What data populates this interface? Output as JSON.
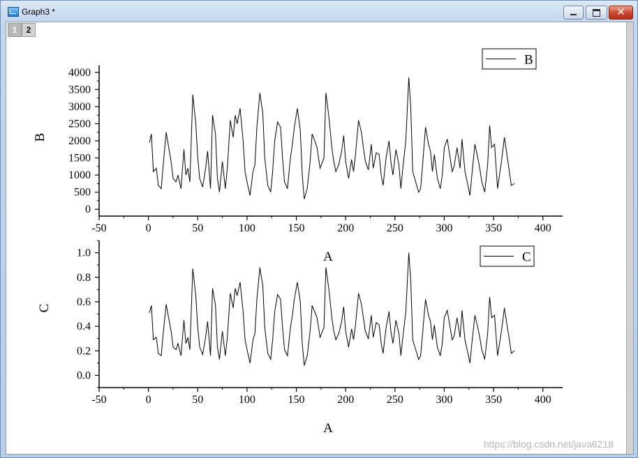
{
  "window": {
    "title": "Graph3 *"
  },
  "pages": [
    "1",
    "2"
  ],
  "watermark": "https://blog.csdn.net/java6218",
  "chart_data": [
    {
      "type": "line",
      "xlabel": "A",
      "ylabel": "B",
      "xlim": [
        -50,
        420
      ],
      "ylim": [
        -200,
        4200
      ],
      "xticks": [
        -50,
        0,
        50,
        100,
        150,
        200,
        250,
        300,
        350,
        400
      ],
      "yticks": [
        0,
        500,
        1000,
        1500,
        2000,
        2500,
        3000,
        3500,
        4000
      ],
      "legend": {
        "entries": [
          "B"
        ],
        "placement": "top-right"
      },
      "grid": false,
      "series": [
        {
          "name": "B",
          "x": [
            1,
            3,
            5,
            8,
            10,
            13,
            15,
            18,
            20,
            23,
            25,
            28,
            30,
            33,
            36,
            38,
            40,
            42,
            45,
            48,
            50,
            52,
            55,
            58,
            60,
            63,
            65,
            68,
            70,
            72,
            75,
            78,
            80,
            83,
            86,
            88,
            90,
            93,
            96,
            98,
            100,
            103,
            106,
            108,
            110,
            113,
            116,
            118,
            121,
            124,
            126,
            128,
            131,
            134,
            136,
            138,
            141,
            144,
            146,
            148,
            151,
            154,
            156,
            158,
            161,
            164,
            166,
            168,
            171,
            174,
            176,
            178,
            180,
            183,
            186,
            188,
            190,
            193,
            196,
            198,
            200,
            203,
            206,
            208,
            210,
            213,
            216,
            218,
            220,
            223,
            226,
            228,
            231,
            234,
            236,
            238,
            241,
            244,
            246,
            248,
            251,
            254,
            256,
            258,
            261,
            264,
            266,
            268,
            271,
            274,
            276,
            278,
            281,
            284,
            286,
            288,
            290,
            293,
            296,
            298,
            300,
            303,
            306,
            308,
            310,
            313,
            316,
            318,
            321,
            324,
            326,
            328,
            331,
            334,
            336,
            338,
            341,
            344,
            346,
            348,
            351,
            354,
            356,
            358,
            361,
            364,
            366,
            368,
            371
          ],
          "values": [
            1950,
            2200,
            1100,
            1200,
            700,
            600,
            1300,
            2250,
            1900,
            1400,
            900,
            800,
            1000,
            600,
            1750,
            1000,
            1200,
            800,
            3350,
            2500,
            1500,
            900,
            650,
            1200,
            1700,
            600,
            2750,
            2200,
            900,
            500,
            1400,
            600,
            1200,
            2600,
            2100,
            2750,
            2500,
            2950,
            2000,
            1100,
            800,
            400,
            1100,
            1300,
            2400,
            3400,
            2800,
            1500,
            700,
            500,
            1100,
            2000,
            2550,
            2400,
            1500,
            800,
            600,
            1500,
            1900,
            2400,
            2950,
            2300,
            1000,
            300,
            600,
            1400,
            2200,
            2050,
            1800,
            1200,
            1350,
            1500,
            3400,
            2700,
            1800,
            1400,
            1100,
            1300,
            1700,
            2150,
            1400,
            900,
            1450,
            1100,
            1600,
            2600,
            2250,
            1800,
            1400,
            1150,
            1900,
            1200,
            1650,
            1600,
            1000,
            700,
            1500,
            2000,
            1350,
            1000,
            1750,
            1300,
            600,
            1200,
            2000,
            3850,
            3000,
            1100,
            800,
            500,
            600,
            1300,
            2400,
            1900,
            1700,
            1100,
            1600,
            900,
            600,
            1000,
            1800,
            2050,
            1500,
            1100,
            1250,
            1800,
            1200,
            2050,
            1100,
            700,
            400,
            1000,
            1900,
            1500,
            1200,
            800,
            500,
            1300,
            2450,
            1800,
            1900,
            600,
            1000,
            1400,
            2100,
            1500,
            1100,
            700,
            750
          ]
        }
      ]
    },
    {
      "type": "line",
      "xlabel": "A",
      "ylabel": "C",
      "xlim": [
        -50,
        420
      ],
      "ylim": [
        -0.1,
        1.1
      ],
      "xticks": [
        -50,
        0,
        50,
        100,
        150,
        200,
        250,
        300,
        350,
        400
      ],
      "yticks": [
        0.0,
        0.2,
        0.4,
        0.6,
        0.8,
        1.0
      ],
      "yticklabels": [
        "0.0",
        "0.2",
        "0.4",
        "0.6",
        "0.8",
        "1.0"
      ],
      "legend": {
        "entries": [
          "C"
        ],
        "placement": "top-right"
      },
      "grid": false,
      "series": [
        {
          "name": "C",
          "x": [
            1,
            3,
            5,
            8,
            10,
            13,
            15,
            18,
            20,
            23,
            25,
            28,
            30,
            33,
            36,
            38,
            40,
            42,
            45,
            48,
            50,
            52,
            55,
            58,
            60,
            63,
            65,
            68,
            70,
            72,
            75,
            78,
            80,
            83,
            86,
            88,
            90,
            93,
            96,
            98,
            100,
            103,
            106,
            108,
            110,
            113,
            116,
            118,
            121,
            124,
            126,
            128,
            131,
            134,
            136,
            138,
            141,
            144,
            146,
            148,
            151,
            154,
            156,
            158,
            161,
            164,
            166,
            168,
            171,
            174,
            176,
            178,
            180,
            183,
            186,
            188,
            190,
            193,
            196,
            198,
            200,
            203,
            206,
            208,
            210,
            213,
            216,
            218,
            220,
            223,
            226,
            228,
            231,
            234,
            236,
            238,
            241,
            244,
            246,
            248,
            251,
            254,
            256,
            258,
            261,
            264,
            266,
            268,
            271,
            274,
            276,
            278,
            281,
            284,
            286,
            288,
            290,
            293,
            296,
            298,
            300,
            303,
            306,
            308,
            310,
            313,
            316,
            318,
            321,
            324,
            326,
            328,
            331,
            334,
            336,
            338,
            341,
            344,
            346,
            348,
            351,
            354,
            356,
            358,
            361,
            364,
            366,
            368,
            371
          ],
          "values": [
            0.51,
            0.57,
            0.29,
            0.31,
            0.18,
            0.16,
            0.34,
            0.58,
            0.49,
            0.36,
            0.23,
            0.21,
            0.26,
            0.16,
            0.45,
            0.26,
            0.31,
            0.21,
            0.87,
            0.65,
            0.39,
            0.23,
            0.17,
            0.31,
            0.44,
            0.16,
            0.71,
            0.57,
            0.23,
            0.13,
            0.36,
            0.16,
            0.31,
            0.67,
            0.55,
            0.71,
            0.65,
            0.76,
            0.52,
            0.29,
            0.21,
            0.1,
            0.29,
            0.34,
            0.62,
            0.88,
            0.73,
            0.39,
            0.18,
            0.13,
            0.29,
            0.52,
            0.66,
            0.62,
            0.39,
            0.21,
            0.16,
            0.39,
            0.49,
            0.62,
            0.76,
            0.6,
            0.26,
            0.08,
            0.16,
            0.36,
            0.57,
            0.53,
            0.47,
            0.31,
            0.35,
            0.39,
            0.88,
            0.7,
            0.47,
            0.36,
            0.29,
            0.34,
            0.44,
            0.56,
            0.36,
            0.23,
            0.38,
            0.29,
            0.41,
            0.67,
            0.58,
            0.47,
            0.36,
            0.3,
            0.49,
            0.31,
            0.43,
            0.41,
            0.26,
            0.18,
            0.39,
            0.52,
            0.35,
            0.26,
            0.45,
            0.34,
            0.16,
            0.31,
            0.52,
            1.0,
            0.78,
            0.29,
            0.21,
            0.13,
            0.16,
            0.34,
            0.62,
            0.49,
            0.44,
            0.29,
            0.41,
            0.23,
            0.16,
            0.26,
            0.47,
            0.53,
            0.39,
            0.29,
            0.32,
            0.47,
            0.31,
            0.53,
            0.29,
            0.18,
            0.1,
            0.26,
            0.49,
            0.39,
            0.31,
            0.21,
            0.13,
            0.34,
            0.64,
            0.47,
            0.49,
            0.16,
            0.26,
            0.36,
            0.55,
            0.39,
            0.29,
            0.18,
            0.2
          ]
        }
      ]
    }
  ]
}
